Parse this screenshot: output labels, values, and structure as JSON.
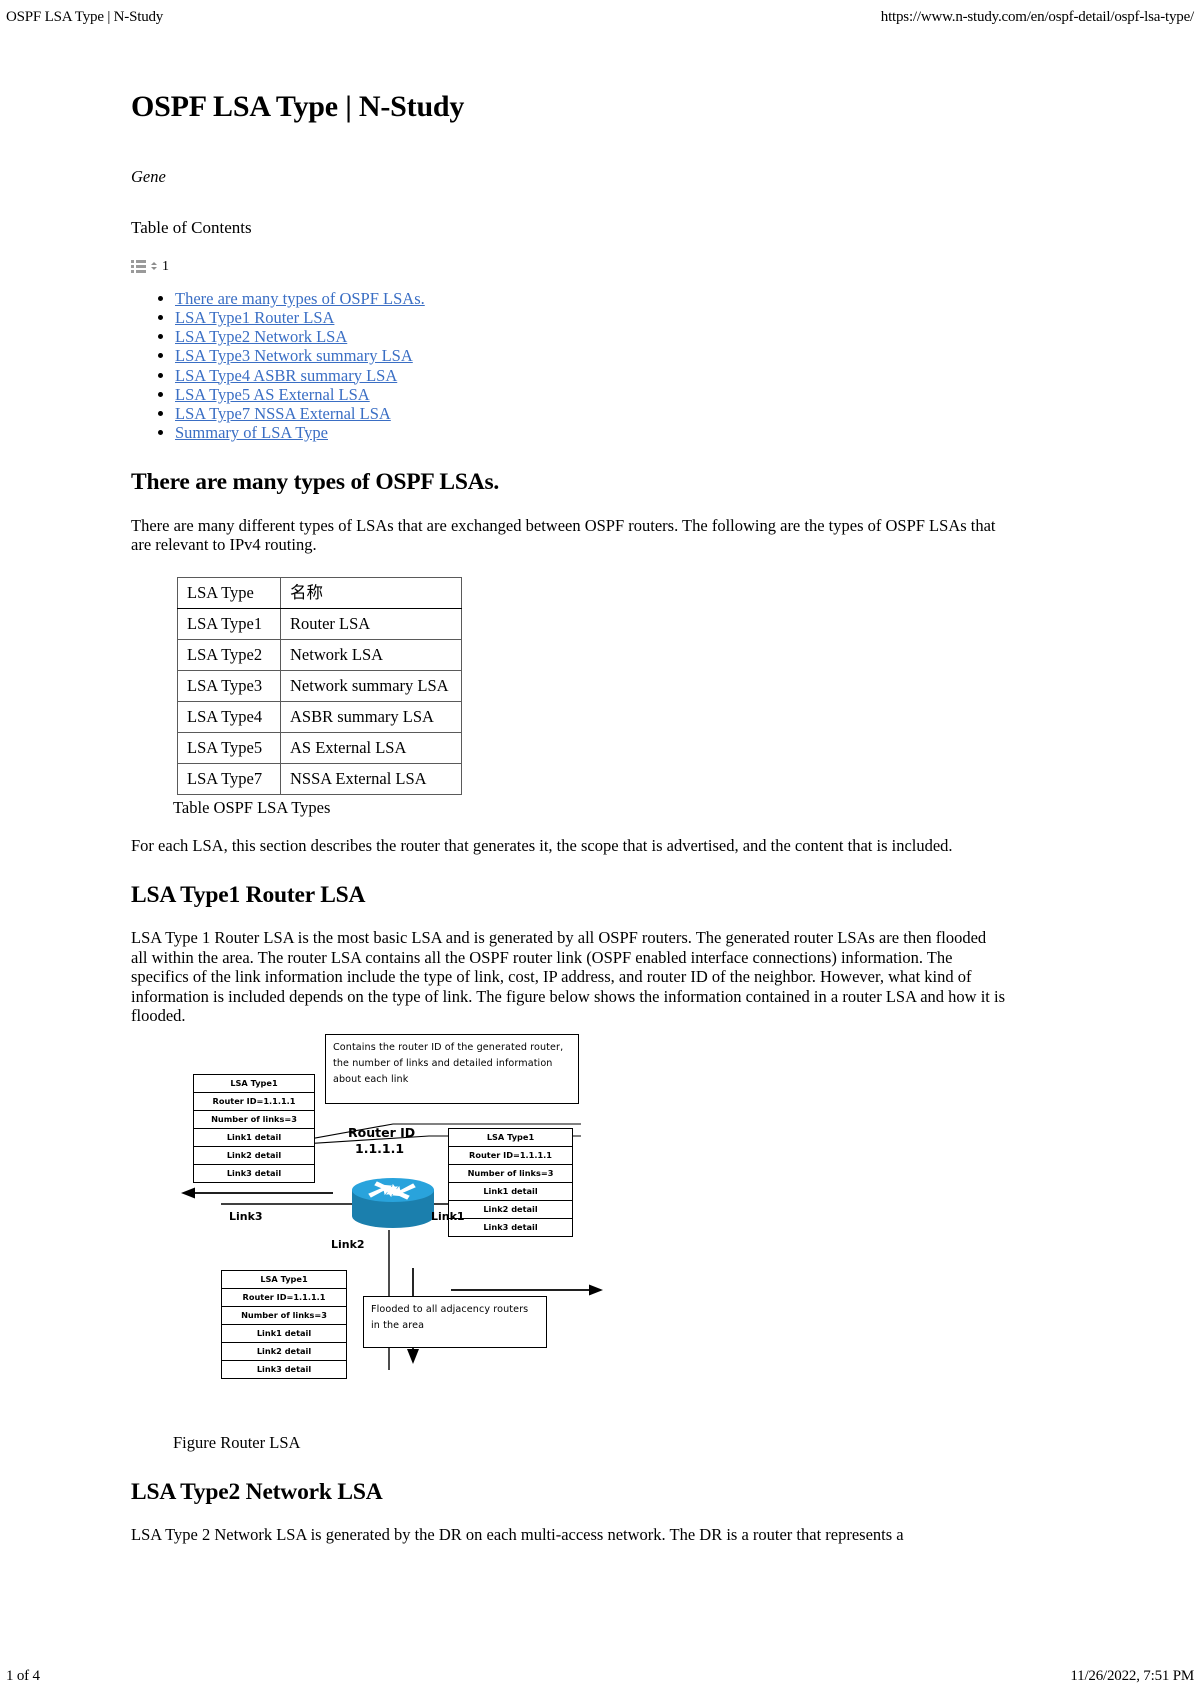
{
  "print_header": {
    "title": "OSPF LSA Type | N-Study",
    "url": "https://www.n-study.com/en/ospf-detail/ospf-lsa-type/"
  },
  "print_footer": {
    "page": "1 of 4",
    "timestamp": "11/26/2022, 7:51 PM"
  },
  "document": {
    "title": "OSPF LSA Type | N-Study",
    "author": "Gene",
    "toc_heading": "Table of Contents",
    "toc_count": "1",
    "toc_items": [
      {
        "label": "There are many types of OSPF LSAs."
      },
      {
        "label": "LSA Type1 Router LSA"
      },
      {
        "label": "LSA Type2 Network LSA"
      },
      {
        "label": "LSA Type3 Network summary LSA"
      },
      {
        "label": "LSA Type4 ASBR summary LSA"
      },
      {
        "label": "LSA Type5 AS External LSA"
      },
      {
        "label": "LSA Type7 NSSA External LSA"
      },
      {
        "label": "Summary of LSA Type"
      }
    ],
    "link_color": "#3a6ec4",
    "sections": [
      {
        "heading": "There are many types of OSPF LSAs.",
        "paragraph": "There are many different types of LSAs that are exchanged between OSPF routers. The following are the types of OSPF LSAs that are relevant to IPv4 routing.",
        "paragraph2": "For each LSA, this section describes the router that generates it, the scope that is advertised, and the content that is included."
      },
      {
        "heading": "LSA Type1 Router LSA",
        "paragraph": "LSA Type 1 Router LSA is the most basic LSA and is generated by all OSPF routers. The generated router LSAs are then flooded all within the area. The router LSA contains all the OSPF router link (OSPF enabled interface connections) information. The specifics of the link information include the type of link, cost, IP address, and router ID of the neighbor. However, what kind of information is included depends on the type of link. The figure below shows the information contained in a router LSA and how it is flooded."
      },
      {
        "heading": "LSA Type2 Network LSA",
        "paragraph": "LSA Type 2 Network LSA is generated by the DR on each multi-access network. The DR is a router that represents a"
      }
    ],
    "table": {
      "caption": "Table OSPF LSA Types",
      "headers": [
        "LSA Type",
        "名称"
      ],
      "rows": [
        [
          "LSA Type1",
          "Router LSA"
        ],
        [
          "LSA Type2",
          "Network LSA"
        ],
        [
          "LSA Type3",
          "Network summary LSA"
        ],
        [
          "LSA Type4",
          "ASBR summary LSA"
        ],
        [
          "LSA Type5",
          "AS External LSA"
        ],
        [
          "LSA Type7",
          "NSSA External LSA"
        ]
      ]
    },
    "figure": {
      "caption": "Figure Router LSA",
      "router_label_line1": "Router ID",
      "router_label_line2": "1.1.1.1",
      "link_labels": [
        "Link1",
        "Link2",
        "Link3"
      ],
      "callout_top": "Contains the router ID of the generated router, the number of links and detailed information about each link",
      "callout_bottom": "Flooded to all adjacency routers in the area",
      "lsa_box_rows": [
        "LSA Type1",
        "Router ID=1.1.1.1",
        "Number of links=3",
        "Link1 detail",
        "Link2 detail",
        "Link3 detail"
      ],
      "router_color": "#29a3dc"
    }
  }
}
